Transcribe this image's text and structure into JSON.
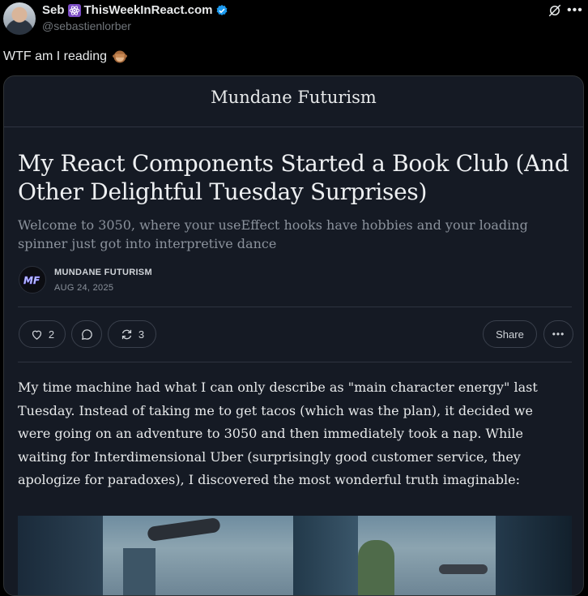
{
  "tweet": {
    "author_name": "Seb",
    "author_brand": "ThisWeekInReact.com",
    "handle": "@sebastienlorber",
    "text": "WTF am I reading",
    "more_icon": "more-horizontal-icon",
    "grok_icon": "grok-icon"
  },
  "card": {
    "publication": "Mundane Futurism",
    "title": "My React Components Started a Book Club (And Other Delightful Tuesday Surprises)",
    "subtitle": "Welcome to 3050, where your useEffect hooks have hobbies and your loading spinner just got into interpretive dance",
    "byline_name": "MUNDANE FUTURISM",
    "byline_date": "AUG 24, 2025",
    "actions": {
      "likes": "2",
      "restacks": "3",
      "share_label": "Share"
    },
    "body": "My time machine had what I can only describe as \"main character energy\" last Tuesday. Instead of taking me to get tacos (which was the plan), it decided we were going on an adventure to 3050 and then immediately took a nap. While waiting for Interdimensional Uber (surprisingly good customer service, they apologize for paradoxes), I discovered the most wonderful truth imaginable:"
  },
  "colors": {
    "background": "#000000",
    "card_background": "#151a24",
    "verified": "#1d9bf0",
    "react_badge": "#7b4cc4"
  }
}
